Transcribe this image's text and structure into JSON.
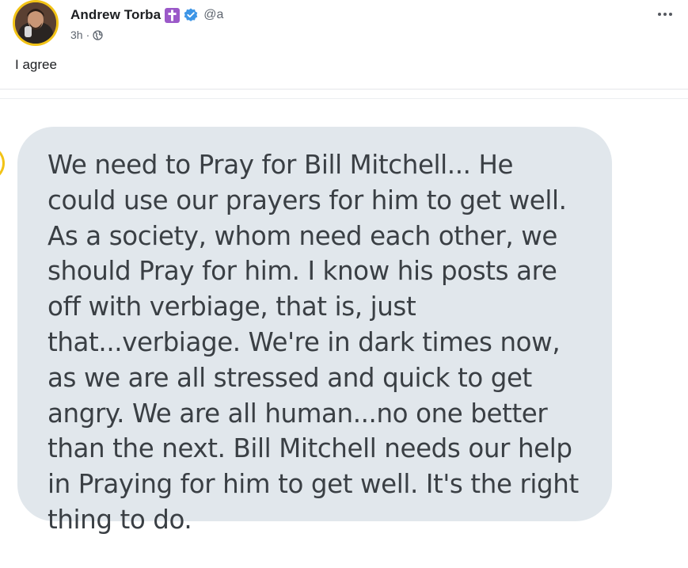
{
  "post": {
    "author_name": "Andrew Torba",
    "handle": "@a",
    "timestamp": "3h",
    "separator": "·",
    "text": "I agree",
    "badges": {
      "cross_icon": "latin-cross-icon",
      "verified_icon": "verified-check-icon",
      "cross_color": "#9b59c8",
      "verified_color": "#3d95e6"
    },
    "visibility_icon": "globe-icon",
    "more_icon": "more-dots-icon"
  },
  "embedded_message": {
    "text": "We need to Pray for Bill Mitchell... He could use our prayers for him to get well. As a society, whom need each other, we should Pray for him. I know his posts are off with verbiage, that is, just that...verbiage. We're in dark times now, as we are all stressed and quick to get angry. We are all human...no one better than the next. Bill Mitchell needs our help in Praying for him to get well. It's the right thing to do.",
    "bubble_color": "#e1e7ec"
  },
  "colors": {
    "avatar_ring": "#f2c316",
    "text_primary": "#1c1e21",
    "text_secondary": "#5f6670"
  }
}
